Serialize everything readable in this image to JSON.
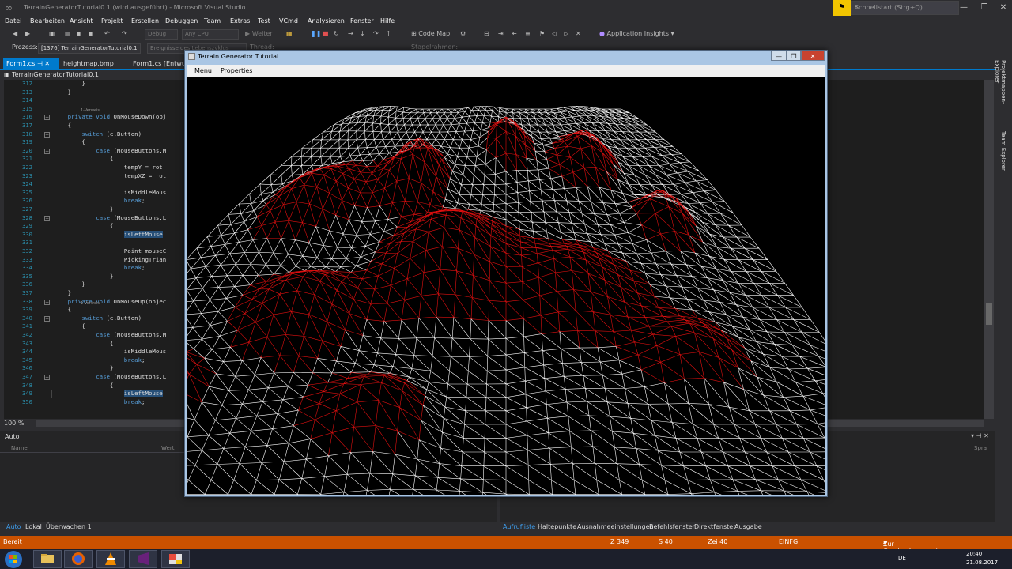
{
  "window": {
    "title": "TerrainGeneratorTutorial0.1 (wird ausgeführt) - Microsoft Visual Studio",
    "quick_launch_placeholder": "Schnellstart (Strg+Q)"
  },
  "menu": [
    "Datei",
    "Bearbeiten",
    "Ansicht",
    "Projekt",
    "Erstellen",
    "Debuggen",
    "Team",
    "Extras",
    "Test",
    "VCmd",
    "Analysieren",
    "Fenster",
    "Hilfe"
  ],
  "toolbar": {
    "config": "Debug",
    "platform": "Any CPU",
    "continue": "Weiter",
    "code_map": "Code Map",
    "app_insights": "Application Insights",
    "lifecycle_events": "Ereignisse des Lebenszyklus",
    "thread": "Thread:",
    "stackframe": "Stapelrahmen:"
  },
  "process": {
    "label": "Prozess:",
    "value": "[1376] TerrainGeneratorTutorial0.1"
  },
  "tabs": [
    "Form1.cs",
    "heightmap.bmp",
    "Form1.cs [Entwurf]"
  ],
  "nav_project": "TerrainGeneratorTutorial0.1",
  "code_lines": [
    {
      "n": "312",
      "t": "            }"
    },
    {
      "n": "313",
      "t": "        }"
    },
    {
      "n": "314",
      "t": ""
    },
    {
      "n": "315",
      "t": ""
    },
    {
      "n": "316",
      "t": "        private void OnMouseDown(obj"
    },
    {
      "n": "317",
      "t": "        {"
    },
    {
      "n": "318",
      "t": "            switch (e.Button)"
    },
    {
      "n": "319",
      "t": "            {"
    },
    {
      "n": "320",
      "t": "                case (MouseButtons.M"
    },
    {
      "n": "321",
      "t": "                    {"
    },
    {
      "n": "322",
      "t": "                        tempY = rot"
    },
    {
      "n": "323",
      "t": "                        tempXZ = rot"
    },
    {
      "n": "324",
      "t": ""
    },
    {
      "n": "325",
      "t": "                        isMiddleMous"
    },
    {
      "n": "326",
      "t": "                        break;"
    },
    {
      "n": "327",
      "t": "                    }"
    },
    {
      "n": "328",
      "t": "                case (MouseButtons.L"
    },
    {
      "n": "329",
      "t": "                    {"
    },
    {
      "n": "330",
      "t": "                        isLeftMouse"
    },
    {
      "n": "331",
      "t": ""
    },
    {
      "n": "332",
      "t": "                        Point mouseC"
    },
    {
      "n": "333",
      "t": "                        PickingTrian"
    },
    {
      "n": "334",
      "t": "                        break;"
    },
    {
      "n": "335",
      "t": "                    }"
    },
    {
      "n": "336",
      "t": "            }"
    },
    {
      "n": "337",
      "t": "        }"
    },
    {
      "n": "338",
      "t": "        private void OnMouseUp(objec"
    },
    {
      "n": "339",
      "t": "        {"
    },
    {
      "n": "340",
      "t": "            switch (e.Button)"
    },
    {
      "n": "341",
      "t": "            {"
    },
    {
      "n": "342",
      "t": "                case (MouseButtons.M"
    },
    {
      "n": "343",
      "t": "                    {"
    },
    {
      "n": "344",
      "t": "                        isMiddleMous"
    },
    {
      "n": "345",
      "t": "                        break;"
    },
    {
      "n": "346",
      "t": "                    }"
    },
    {
      "n": "347",
      "t": "                case (MouseButtons.L"
    },
    {
      "n": "348",
      "t": "                    {"
    },
    {
      "n": "349",
      "t": "                        isLeftMouse"
    },
    {
      "n": "350",
      "t": "                        break;"
    }
  ],
  "refs": [
    "1-Verweis",
    "1-Verweis"
  ],
  "zoom": "100 %",
  "auto_panel": {
    "title": "Auto",
    "col_name": "Name",
    "col_value": "Wert",
    "col_lang": "Spra"
  },
  "bottom_tabs_left": [
    "Auto",
    "Lokal",
    "Überwachen 1"
  ],
  "bottom_tabs_right": [
    "Aufrufliste",
    "Haltepunkte",
    "Ausnahmeeinstellungen",
    "Befehlsfenster",
    "Direktfenster",
    "Ausgabe"
  ],
  "status": {
    "state": "Bereit",
    "line": "Z 349",
    "col": "S 40",
    "char": "Zei 40",
    "mode": "EINFG",
    "source_control": "Zur Quellcodeverwaltung hinzufügen"
  },
  "right_rail": [
    "Projektmappen-Explorer",
    "Team Explorer"
  ],
  "taskbar": {
    "lang": "DE",
    "time": "20:40",
    "date": "21.08.2017"
  },
  "app_window": {
    "title": "Terrain Generator Tutorial",
    "menu": [
      "Menu",
      "Properties"
    ]
  },
  "colors": {
    "accent": "#007acc",
    "status": "#ca5100",
    "mesh_high": "#e01010",
    "mesh_low": "#ffffff"
  }
}
